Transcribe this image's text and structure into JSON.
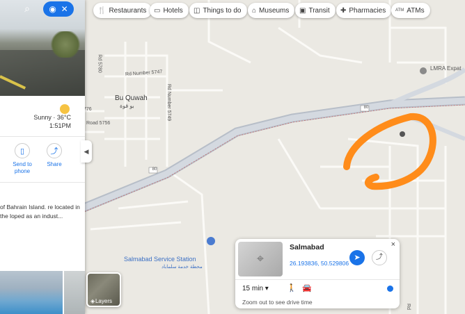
{
  "chips": [
    {
      "icon": "restaurant-icon",
      "glyph": "🍴",
      "label": "Restaurants"
    },
    {
      "icon": "hotel-icon",
      "glyph": "🛏",
      "label": "Hotels"
    },
    {
      "icon": "camera-icon",
      "glyph": "📷",
      "label": "Things to do"
    },
    {
      "icon": "museum-icon",
      "glyph": "🏛",
      "label": "Museums"
    },
    {
      "icon": "transit-icon",
      "glyph": "🚆",
      "label": "Transit"
    },
    {
      "icon": "pharmacy-icon",
      "glyph": "✚",
      "label": "Pharmacies"
    },
    {
      "icon": "atm-icon",
      "glyph": "ATM",
      "label": "ATMs"
    }
  ],
  "left_panel": {
    "weather_condition": "Sunny · 36°C",
    "weather_time": "1:51PM",
    "temp_left": "",
    "actions": [
      {
        "icon": "send-to-phone-icon",
        "glyph": "▯",
        "label": "Send to phone"
      },
      {
        "icon": "share-icon",
        "glyph": "≺",
        "label": "Share"
      }
    ],
    "description": "of Bahrain Island. re located in the loped as an indust..."
  },
  "map_labels": {
    "bu_quwah": "Bu Quwah",
    "bu_quwah_ar": "بو قوة",
    "rd5747": "Rd Number 5747",
    "rd5749": "Rd Number 5749",
    "rd5780": "Rd 5780",
    "road5756": "Road 5756",
    "n776": "776",
    "rd80a": "80",
    "rd80b": "80",
    "service_station": "Salmabad Service Station",
    "service_station_ar": "محطة خدمة سلماباد",
    "lmra": "LMRA Expat",
    "right_label": "Rd"
  },
  "info_card": {
    "title": "Salmabad",
    "coords": "26.193836, 50.529806",
    "time": "15 min ▾",
    "hint": "Zoom out to see drive time",
    "close": "×"
  },
  "layers": {
    "label": "Layers"
  },
  "colors": {
    "accent": "#1a73e8",
    "annotation": "#ff8c1a",
    "highway": "#c7cdd6",
    "map_bg": "#ebe9e3"
  }
}
